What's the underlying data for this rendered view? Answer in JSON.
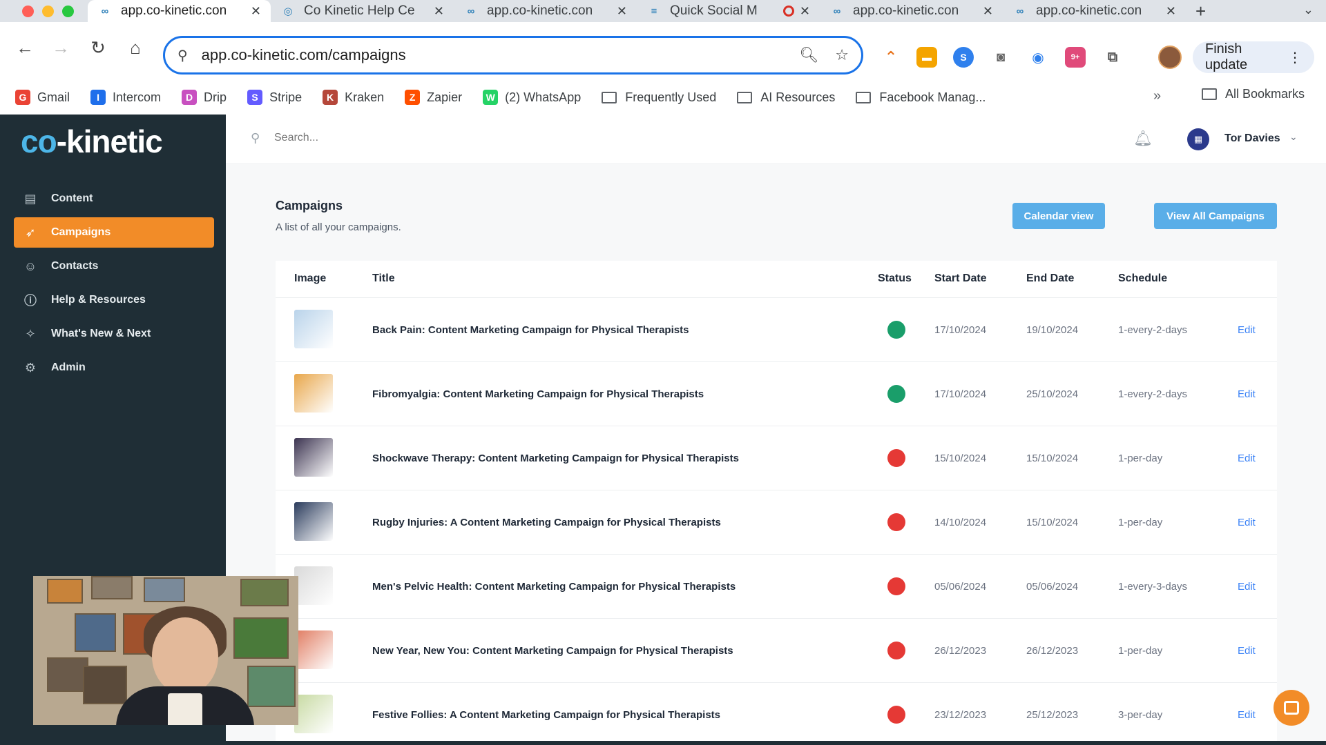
{
  "browser": {
    "tabs": [
      {
        "title": "app.co-kinetic.con",
        "favicon": "co-kinetic-icon",
        "active": true
      },
      {
        "title": "Co Kinetic Help Ce",
        "favicon": "help-center-icon",
        "active": false
      },
      {
        "title": "app.co-kinetic.con",
        "favicon": "co-kinetic-icon",
        "active": false
      },
      {
        "title": "Quick Social M",
        "favicon": "doc-icon",
        "active": false,
        "recording": true
      },
      {
        "title": "app.co-kinetic.con",
        "favicon": "co-kinetic-icon",
        "active": false
      },
      {
        "title": "app.co-kinetic.con",
        "favicon": "co-kinetic-icon",
        "active": false
      }
    ],
    "url": "app.co-kinetic.com/campaigns",
    "finish_update_label": "Finish update",
    "bookmarks": [
      {
        "label": "Gmail",
        "icon": "gmail-icon",
        "color": "#ea4335"
      },
      {
        "label": "Intercom",
        "icon": "intercom-icon",
        "color": "#1f6feb"
      },
      {
        "label": "Drip",
        "icon": "drip-icon",
        "color": "#c850c0"
      },
      {
        "label": "Stripe",
        "icon": "stripe-icon",
        "color": "#635bff"
      },
      {
        "label": "Kraken",
        "icon": "kraken-icon",
        "color": "#b5473a"
      },
      {
        "label": "Zapier",
        "icon": "zapier-icon",
        "color": "#ff4f00"
      },
      {
        "label": "(2) WhatsApp",
        "icon": "whatsapp-icon",
        "color": "#25d366"
      },
      {
        "label": "Frequently Used",
        "icon": "folder-icon"
      },
      {
        "label": "AI Resources",
        "icon": "folder-icon"
      },
      {
        "label": "Facebook Manag...",
        "icon": "folder-icon"
      }
    ],
    "all_bookmarks_label": "All Bookmarks"
  },
  "app": {
    "logo_prefix": "co",
    "logo_suffix": "-kinetic",
    "accent_color": "#f28c28",
    "sidebar_bg": "#1f2e36",
    "nav": [
      {
        "label": "Content",
        "icon": "content-icon",
        "glyph": "▤",
        "active": false
      },
      {
        "label": "Campaigns",
        "icon": "rocket-icon",
        "glyph": "➶",
        "active": true
      },
      {
        "label": "Contacts",
        "icon": "contacts-icon",
        "glyph": "☺",
        "active": false
      },
      {
        "label": "Help & Resources",
        "icon": "info-icon",
        "glyph": "ⓘ",
        "active": false
      },
      {
        "label": "What's New & Next",
        "icon": "sparkle-icon",
        "glyph": "✧",
        "active": false
      },
      {
        "label": "Admin",
        "icon": "gear-icon",
        "glyph": "⚙",
        "active": false
      }
    ],
    "search_placeholder": "Search...",
    "user_name": "Tor Davies"
  },
  "campaigns": {
    "title": "Campaigns",
    "subtitle": "A list of all your campaigns.",
    "calendar_button": "Calendar view",
    "view_all_button": "View All Campaigns",
    "columns": [
      "Image",
      "Title",
      "Status",
      "Start Date",
      "End Date",
      "Schedule"
    ],
    "rows": [
      {
        "title": "Back Pain: Content Marketing Campaign for Physical Therapists",
        "status": "active",
        "status_color": "#1a9e6a",
        "start": "17/10/2024",
        "end": "19/10/2024",
        "schedule": "1-every-2-days",
        "action": "Edit",
        "thumb_color": "#b9d3ea"
      },
      {
        "title": "Fibromyalgia: Content Marketing Campaign for Physical Therapists",
        "status": "active",
        "status_color": "#1a9e6a",
        "start": "17/10/2024",
        "end": "25/10/2024",
        "schedule": "1-every-2-days",
        "action": "Edit",
        "thumb_color": "#e8a64a"
      },
      {
        "title": "Shockwave Therapy: Content Marketing Campaign for Physical Therapists",
        "status": "inactive",
        "status_color": "#e53935",
        "start": "15/10/2024",
        "end": "15/10/2024",
        "schedule": "1-per-day",
        "action": "Edit",
        "thumb_color": "#3b3350"
      },
      {
        "title": "Rugby Injuries: A Content Marketing Campaign for Physical Therapists",
        "status": "inactive",
        "status_color": "#e53935",
        "start": "14/10/2024",
        "end": "15/10/2024",
        "schedule": "1-per-day",
        "action": "Edit",
        "thumb_color": "#2a3b5c"
      },
      {
        "title": "Men's Pelvic Health: Content Marketing Campaign for Physical Therapists",
        "status": "inactive",
        "status_color": "#e53935",
        "start": "05/06/2024",
        "end": "05/06/2024",
        "schedule": "1-every-3-days",
        "action": "Edit",
        "thumb_color": "#d9d9d9"
      },
      {
        "title": "New Year, New You: Content Marketing Campaign for Physical Therapists",
        "status": "inactive",
        "status_color": "#e53935",
        "start": "26/12/2023",
        "end": "26/12/2023",
        "schedule": "1-per-day",
        "action": "Edit",
        "thumb_color": "#e07a5f"
      },
      {
        "title": "Festive Follies: A Content Marketing Campaign for Physical Therapists",
        "status": "inactive",
        "status_color": "#e53935",
        "start": "23/12/2023",
        "end": "25/12/2023",
        "schedule": "3-per-day",
        "action": "Edit",
        "thumb_color": "#c6d9a0"
      }
    ]
  }
}
